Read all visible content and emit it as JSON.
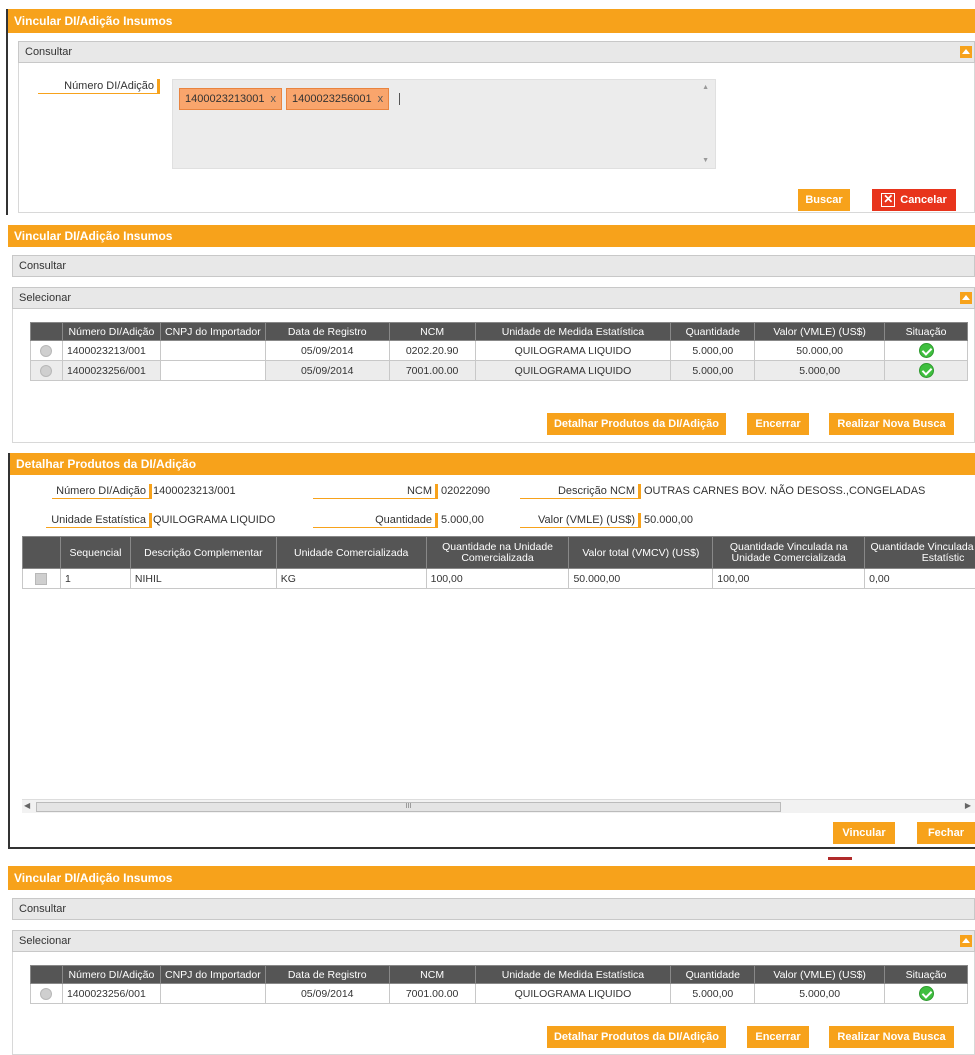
{
  "p1": {
    "title": "Vincular DI/Adição Insumos",
    "consultar": "Consultar",
    "field_label": "Número DI/Adição",
    "chips": [
      {
        "text": "1400023213001",
        "remove": "x"
      },
      {
        "text": "1400023256001",
        "remove": "x"
      }
    ],
    "buscar": "Buscar",
    "cancelar": "Cancelar"
  },
  "p2": {
    "title": "Vincular DI/Adição Insumos",
    "consultar": "Consultar",
    "selecionar": "Selecionar",
    "headers": [
      "Número DI/Adição",
      "CNPJ do Importador",
      "Data de Registro",
      "NCM",
      "Unidade de Medida Estatística",
      "Quantidade",
      "Valor (VMLE) (US$)",
      "Situação"
    ],
    "rows": [
      {
        "numero": "1400023213/001",
        "cnpj": "",
        "data": "05/09/2014",
        "ncm": "0202.20.90",
        "unidade": "QUILOGRAMA LIQUIDO",
        "quantidade": "5.000,00",
        "valor": "50.000,00"
      },
      {
        "numero": "1400023256/001",
        "cnpj": "",
        "data": "05/09/2014",
        "ncm": "7001.00.00",
        "unidade": "QUILOGRAMA LIQUIDO",
        "quantidade": "5.000,00",
        "valor": "5.000,00"
      }
    ],
    "btn_detalhar": "Detalhar Produtos da DI/Adição",
    "btn_encerrar": "Encerrar",
    "btn_nova": "Realizar Nova Busca"
  },
  "p3": {
    "title": "Detalhar Produtos da DI/Adição",
    "fields": {
      "numero_label": "Número DI/Adição",
      "numero_value": "1400023213/001",
      "ncm_label": "NCM",
      "ncm_value": "02022090",
      "desc_label": "Descrição NCM",
      "desc_value": "OUTRAS CARNES BOV. NÃO DESOSS.,CONGELADAS",
      "unidade_label": "Unidade Estatística",
      "unidade_value": "QUILOGRAMA LIQUIDO",
      "qtd_label": "Quantidade",
      "qtd_value": "5.000,00",
      "valor_label": "Valor (VMLE) (US$)",
      "valor_value": "50.000,00"
    },
    "headers": [
      "Sequencial",
      "Descrição Complementar",
      "Unidade Comercializada",
      "Quantidade na Unidade Comercializada",
      "Valor total (VMCV) (US$)",
      "Quantidade Vinculada na Unidade Comercializada",
      "Quantidade Vinculada Unidade Estatístic"
    ],
    "row": {
      "seq": "1",
      "desc": "NIHIL",
      "unidade": "KG",
      "qtd": "100,00",
      "valor": "50.000,00",
      "qtd_vinc": "100,00",
      "qtd_vinc_est": "0,00"
    },
    "scroll_mark": "III",
    "btn_vincular": "Vincular",
    "btn_fechar": "Fechar"
  },
  "p4": {
    "title": "Vincular DI/Adição Insumos",
    "consultar": "Consultar",
    "selecionar": "Selecionar",
    "headers": [
      "Número DI/Adição",
      "CNPJ do Importador",
      "Data de Registro",
      "NCM",
      "Unidade de Medida Estatística",
      "Quantidade",
      "Valor (VMLE) (US$)",
      "Situação"
    ],
    "row": {
      "numero": "1400023256/001",
      "cnpj": "",
      "data": "05/09/2014",
      "ncm": "7001.00.00",
      "unidade": "QUILOGRAMA LIQUIDO",
      "quantidade": "5.000,00",
      "valor": "5.000,00"
    },
    "btn_detalhar": "Detalhar Produtos da DI/Adição",
    "btn_encerrar": "Encerrar",
    "btn_nova": "Realizar Nova Busca"
  }
}
